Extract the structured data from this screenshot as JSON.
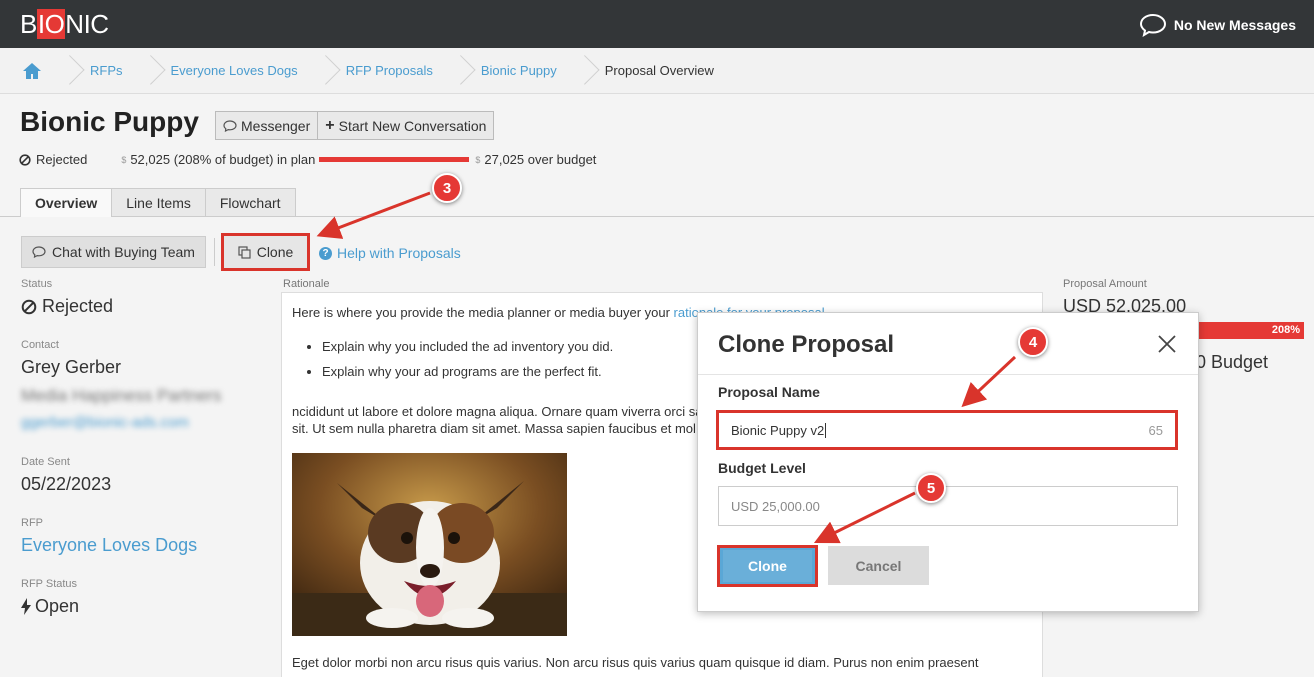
{
  "header": {
    "logo_text_pre": "B",
    "logo_text_io": "IO",
    "logo_text_post": "NIC",
    "messages_label": "No New Messages"
  },
  "breadcrumb": {
    "home_icon": "home-icon",
    "items": [
      "RFPs",
      "Everyone Loves Dogs",
      "RFP Proposals",
      "Bionic Puppy",
      "Proposal Overview"
    ]
  },
  "page": {
    "title": "Bionic Puppy",
    "messenger_label": "Messenger",
    "new_conversation_label": "Start New Conversation",
    "status": "Rejected",
    "plan_text": "52,025 (208% of budget) in plan",
    "over_budget_text": "27,025 over budget",
    "currency_symbol": "$"
  },
  "tabs": [
    "Overview",
    "Line Items",
    "Flowchart"
  ],
  "actions": {
    "chat_label": "Chat with Buying Team",
    "clone_label": "Clone",
    "help_label": "Help with Proposals"
  },
  "details": {
    "status_label": "Status",
    "status_value": "Rejected",
    "contact_label": "Contact",
    "contact_name": "Grey Gerber",
    "contact_company": "Media Happiness Partners",
    "contact_email": "ggerber@bionic-ads.com",
    "date_sent_label": "Date Sent",
    "date_sent_value": "05/22/2023",
    "rfp_label": "RFP",
    "rfp_value": "Everyone Loves Dogs",
    "rfp_status_label": "RFP Status",
    "rfp_status_value": "Open"
  },
  "rationale": {
    "label": "Rationale",
    "intro": "Here is where you provide the media planner or media buyer your ",
    "intro_link": "rationale for your proposal.",
    "bullets": [
      "Explain why you included the ad inventory you did.",
      "Explain why your ad programs are the perfect fit."
    ],
    "para1": "ncididunt ut labore et dolore magna aliqua. Ornare quam viverra orci sa",
    "para1b": "sit. Ut sem nulla pharetra diam sit amet. Massa sapien faucibus et mol",
    "para2": "Eget dolor morbi non arcu risus quis varius. Non arcu risus quis varius quam quisque id diam. Purus non enim praesent"
  },
  "summary": {
    "amount_label": "Proposal Amount",
    "amount_value": "USD 52,025.00",
    "percent": "208%",
    "budget_partial": "0 Budget"
  },
  "modal": {
    "title": "Clone Proposal",
    "name_label": "Proposal Name",
    "name_value": "Bionic Puppy v2",
    "name_count": "65",
    "budget_label": "Budget Level",
    "budget_placeholder": "USD 25,000.00",
    "clone_button": "Clone",
    "cancel_button": "Cancel"
  },
  "callouts": [
    "3",
    "4",
    "5"
  ],
  "colors": {
    "accent_blue": "#4a9ccf",
    "alert_red": "#e53935",
    "topbar": "#333638"
  }
}
